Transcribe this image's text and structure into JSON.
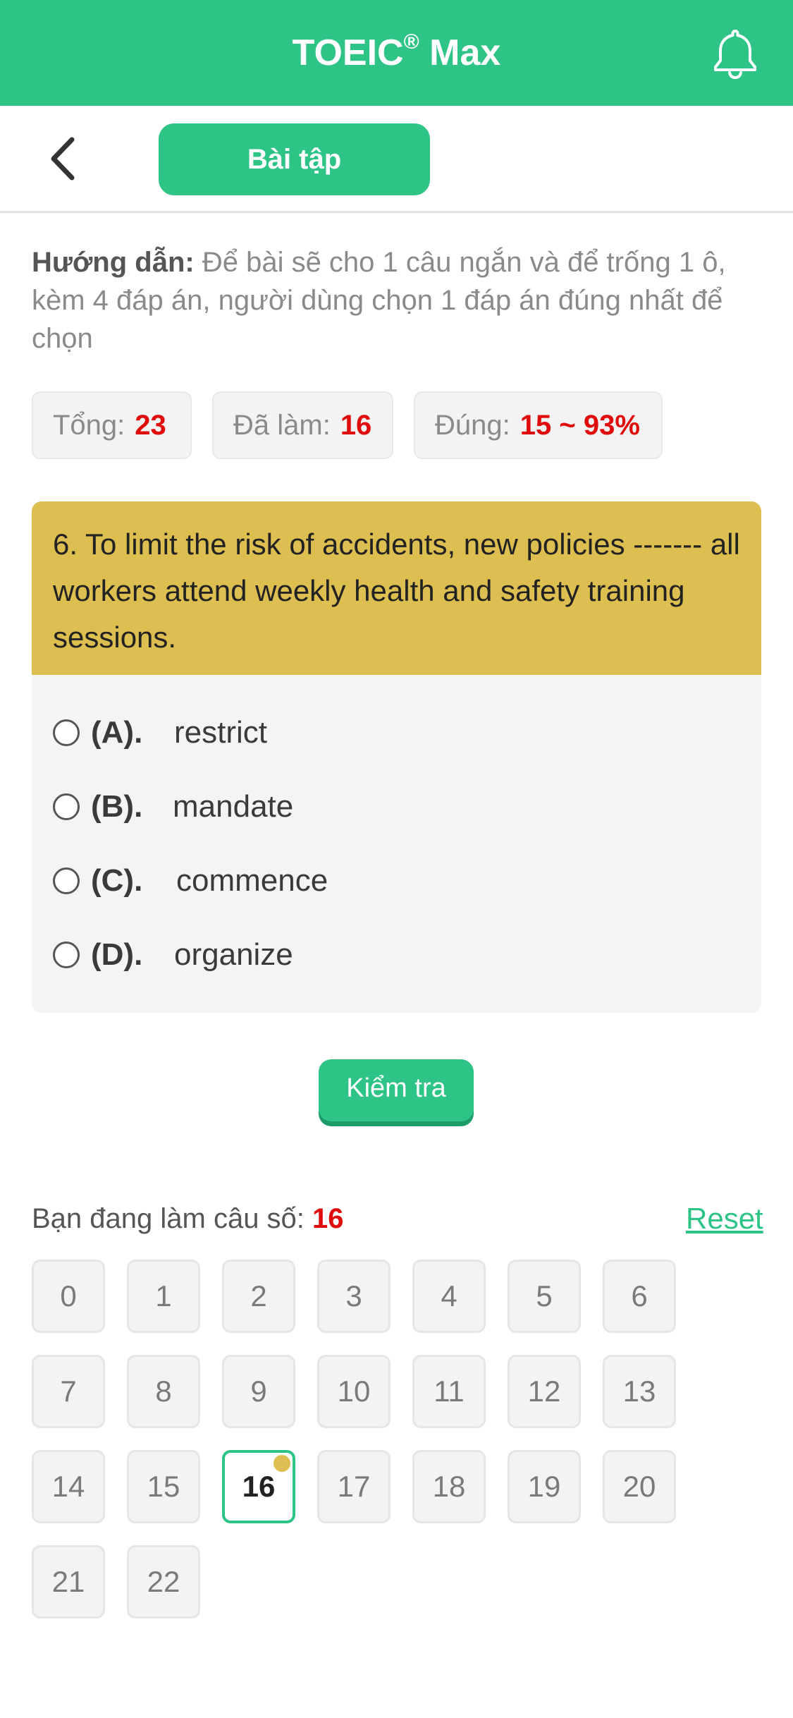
{
  "header": {
    "title": "TOEIC",
    "title_mark": "®",
    "title_suffix": " Max",
    "icon": "bell-icon"
  },
  "subheader": {
    "back_icon": "chevron-left-icon",
    "tab_label": "Bài tập"
  },
  "guide": {
    "label": "Hướng dẫn:",
    "text": "Để bài sẽ cho 1 câu ngắn và để trống 1 ô, kèm 4 đáp án, người dùng chọn 1 đáp án đúng nhất để chọn"
  },
  "stats": {
    "total_label": "Tổng:",
    "total_value": "23",
    "done_label": "Đã làm:",
    "done_value": "16",
    "correct_label": "Đúng:",
    "correct_value": "15 ~ 93%"
  },
  "question": {
    "text": "6. To limit the risk of accidents, new policies ------- all workers attend weekly health and safety training sessions.",
    "options": [
      {
        "letter": "(A).",
        "text": "restrict"
      },
      {
        "letter": "(B).",
        "text": "mandate"
      },
      {
        "letter": "(C).",
        "text": "commence"
      },
      {
        "letter": "(D).",
        "text": "organize"
      }
    ]
  },
  "check_button": "Kiểm tra",
  "progress": {
    "label": "Bạn đang làm câu số:",
    "current": "16",
    "reset_label": "Reset",
    "cells": [
      "0",
      "1",
      "2",
      "3",
      "4",
      "5",
      "6",
      "7",
      "8",
      "9",
      "10",
      "11",
      "12",
      "13",
      "14",
      "15",
      "16",
      "17",
      "18",
      "19",
      "20",
      "21",
      "22"
    ]
  },
  "colors": {
    "accent": "#2dc486",
    "question_bg": "#dcbf50",
    "highlight_red": "#e00b0b"
  }
}
